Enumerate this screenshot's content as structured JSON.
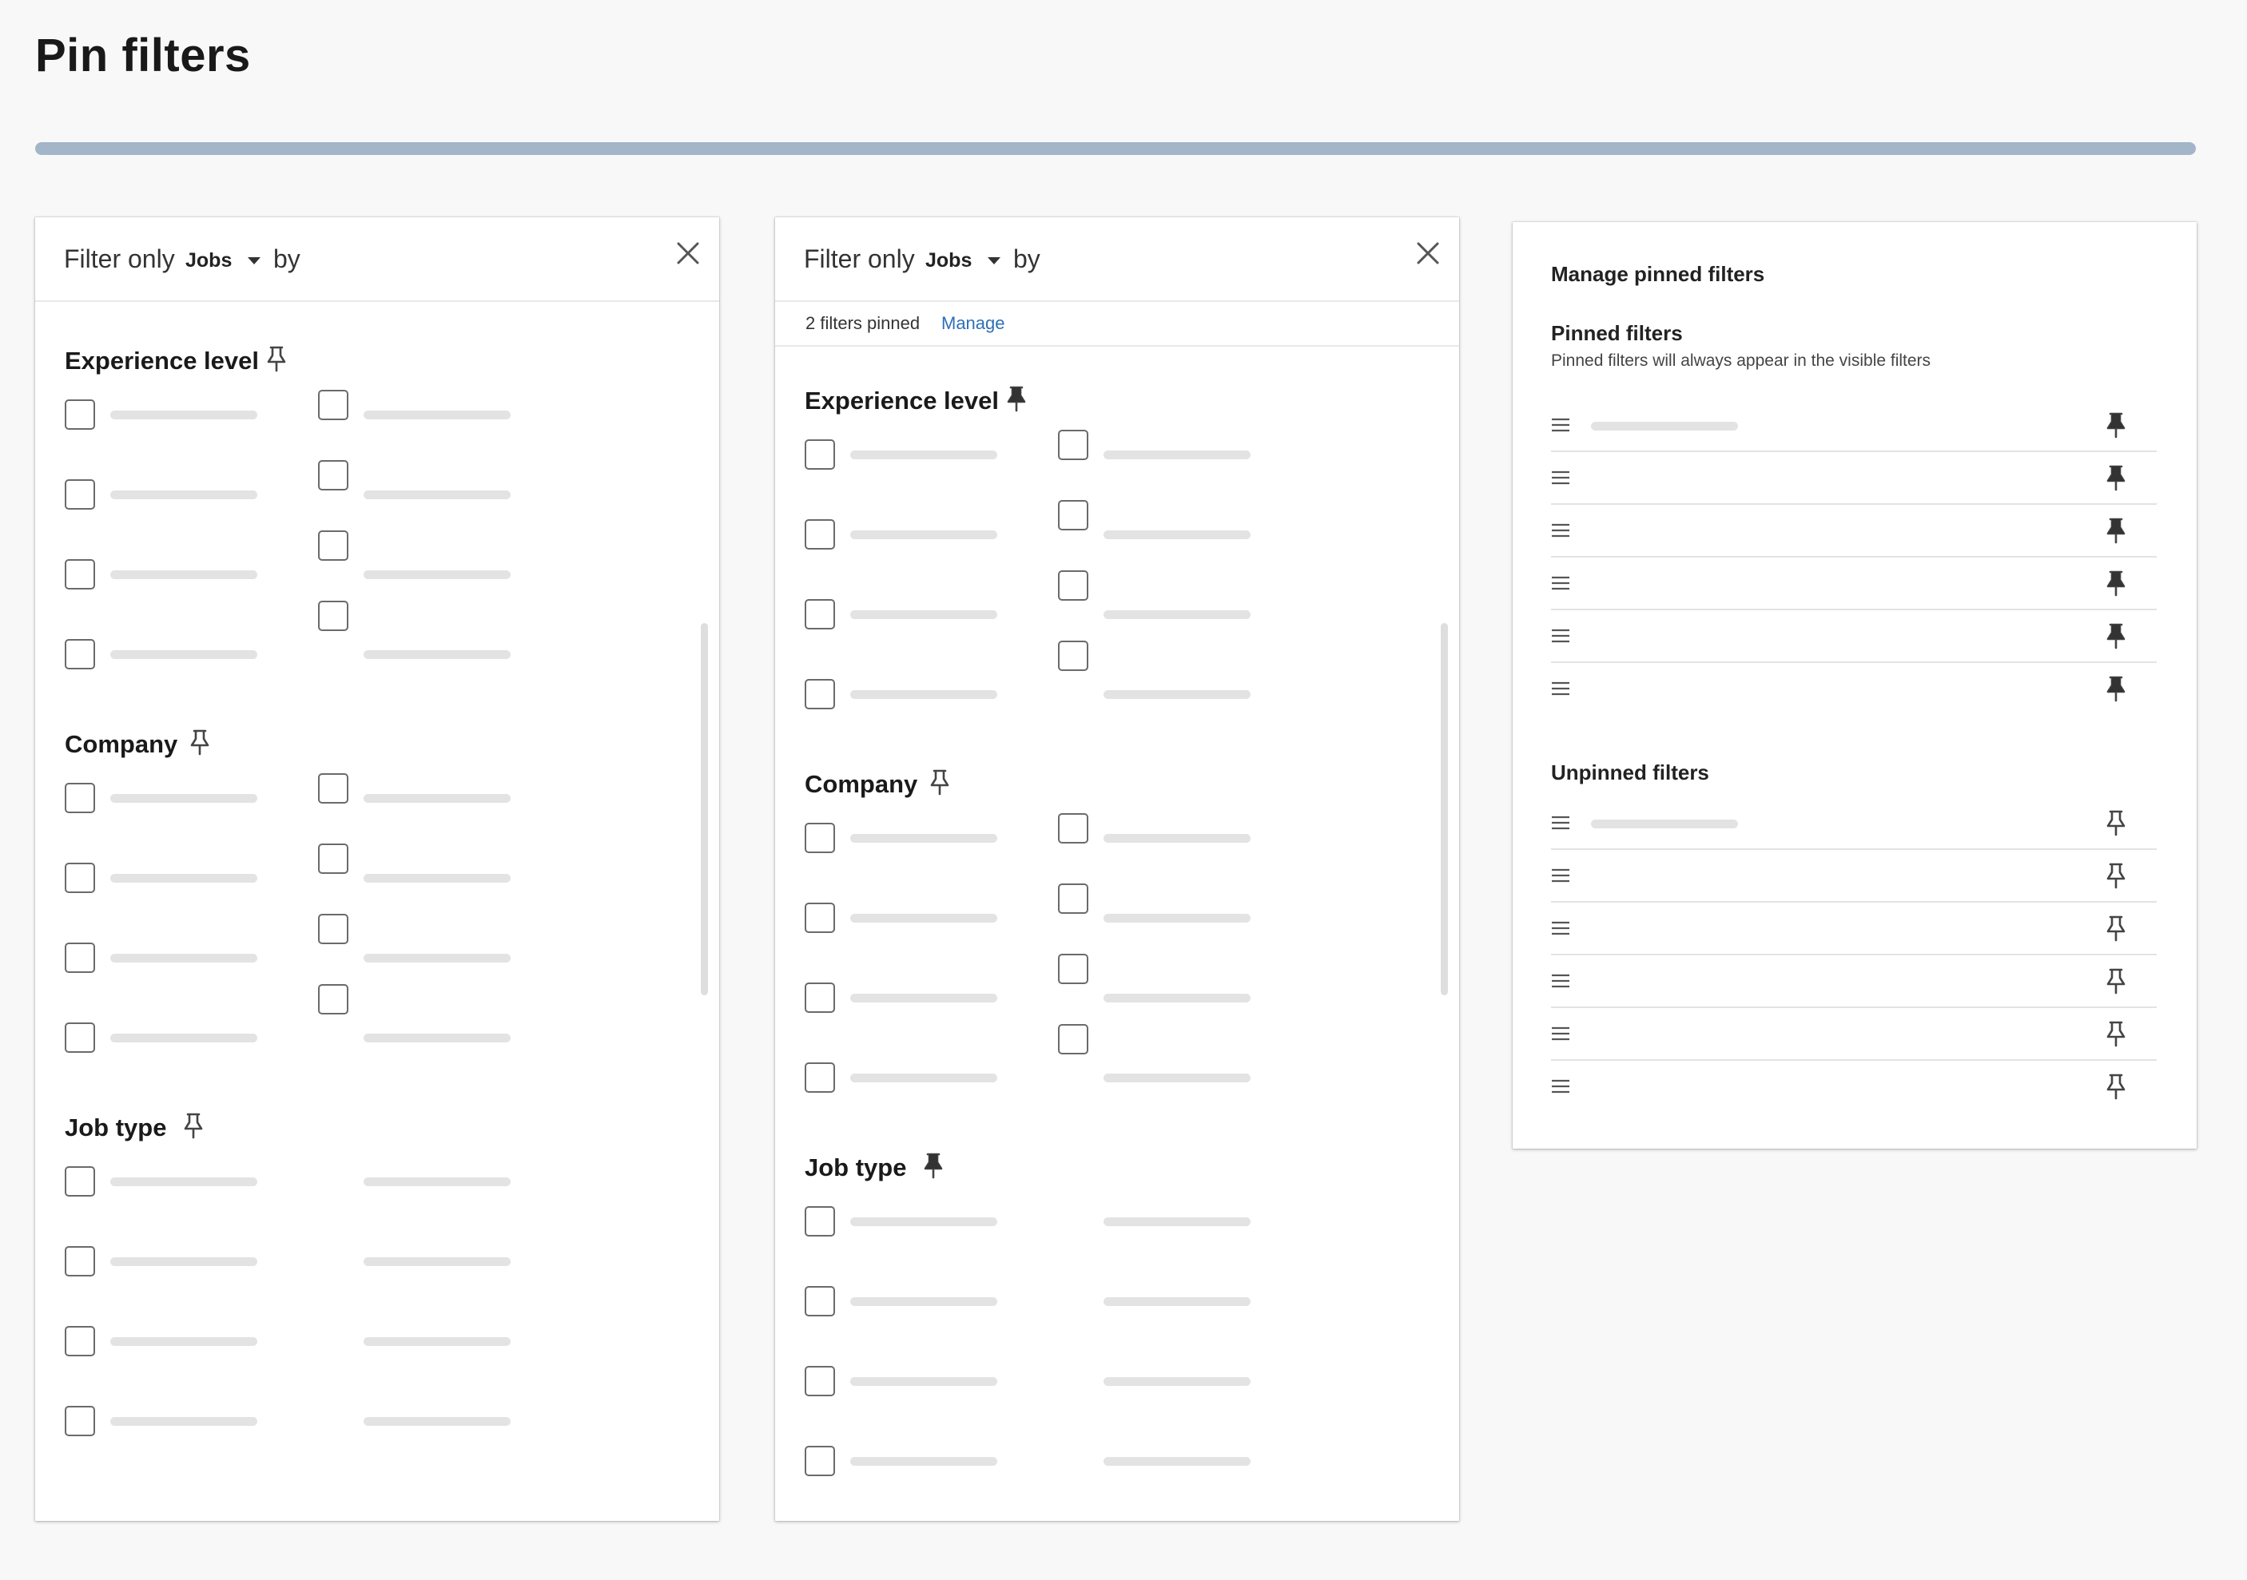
{
  "page": {
    "title": "Pin filters"
  },
  "colors": {
    "accent_bar": "#a3b5c9",
    "link": "#2e6fb7",
    "pin_filled": "#333333",
    "placeholder": "#e3e3e3"
  },
  "panels": [
    {
      "header": {
        "prefix": "Filter only",
        "selected": "Jobs",
        "suffix": "by"
      },
      "sections": [
        {
          "title": "Experience level",
          "pin_icon": "pin-outline-icon"
        },
        {
          "title": "Company",
          "pin_icon": "pin-outline-icon"
        },
        {
          "title": "Job type",
          "pin_icon": "pin-outline-icon"
        }
      ]
    },
    {
      "header": {
        "prefix": "Filter only",
        "selected": "Jobs",
        "suffix": "by"
      },
      "pinned_bar": {
        "count_text": "2 filters pinned",
        "manage_link": "Manage"
      },
      "sections": [
        {
          "title": "Experience level",
          "pin_icon": "pin-filled-icon"
        },
        {
          "title": "Company",
          "pin_icon": "pin-outline-icon"
        },
        {
          "title": "Job type",
          "pin_icon": "pin-filled-icon"
        }
      ]
    }
  ],
  "manage": {
    "title": "Manage pinned filters",
    "pinned_heading": "Pinned filters",
    "pinned_description": "Pinned filters will always appear in the visible filters",
    "unpinned_heading": "Unpinned filters",
    "pinned_row_count": 6,
    "unpinned_row_count": 6
  }
}
